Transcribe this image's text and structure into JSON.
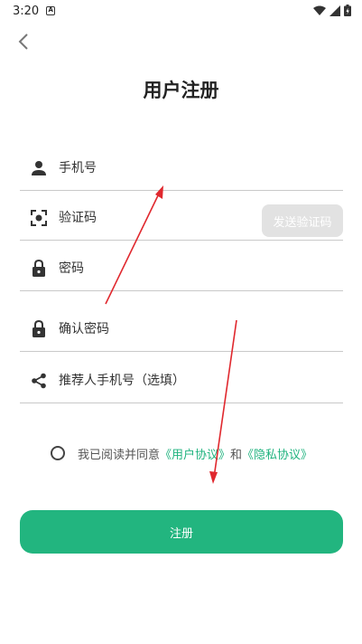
{
  "status_bar": {
    "time": "3:20",
    "notif_glyph": "A"
  },
  "header": {
    "title": "用户注册"
  },
  "form": {
    "phone": {
      "placeholder": "手机号",
      "icon": "person-icon"
    },
    "code": {
      "placeholder": "验证码",
      "icon": "focus-icon",
      "send_label": "发送验证码"
    },
    "password": {
      "placeholder": "密码",
      "icon": "lock-icon"
    },
    "confirm": {
      "placeholder": "确认密码",
      "icon": "lock-icon"
    },
    "referrer": {
      "placeholder": "推荐人手机号（选填）",
      "icon": "share-icon"
    }
  },
  "agreement": {
    "prefix": "我已阅读并同意",
    "user_link": "《用户协议》",
    "joiner": "和",
    "privacy_link": "《隐私协议》"
  },
  "register_label": "注册",
  "colors": {
    "accent": "#22b57f",
    "link": "#20b37f",
    "annotation": "#e0282e"
  }
}
